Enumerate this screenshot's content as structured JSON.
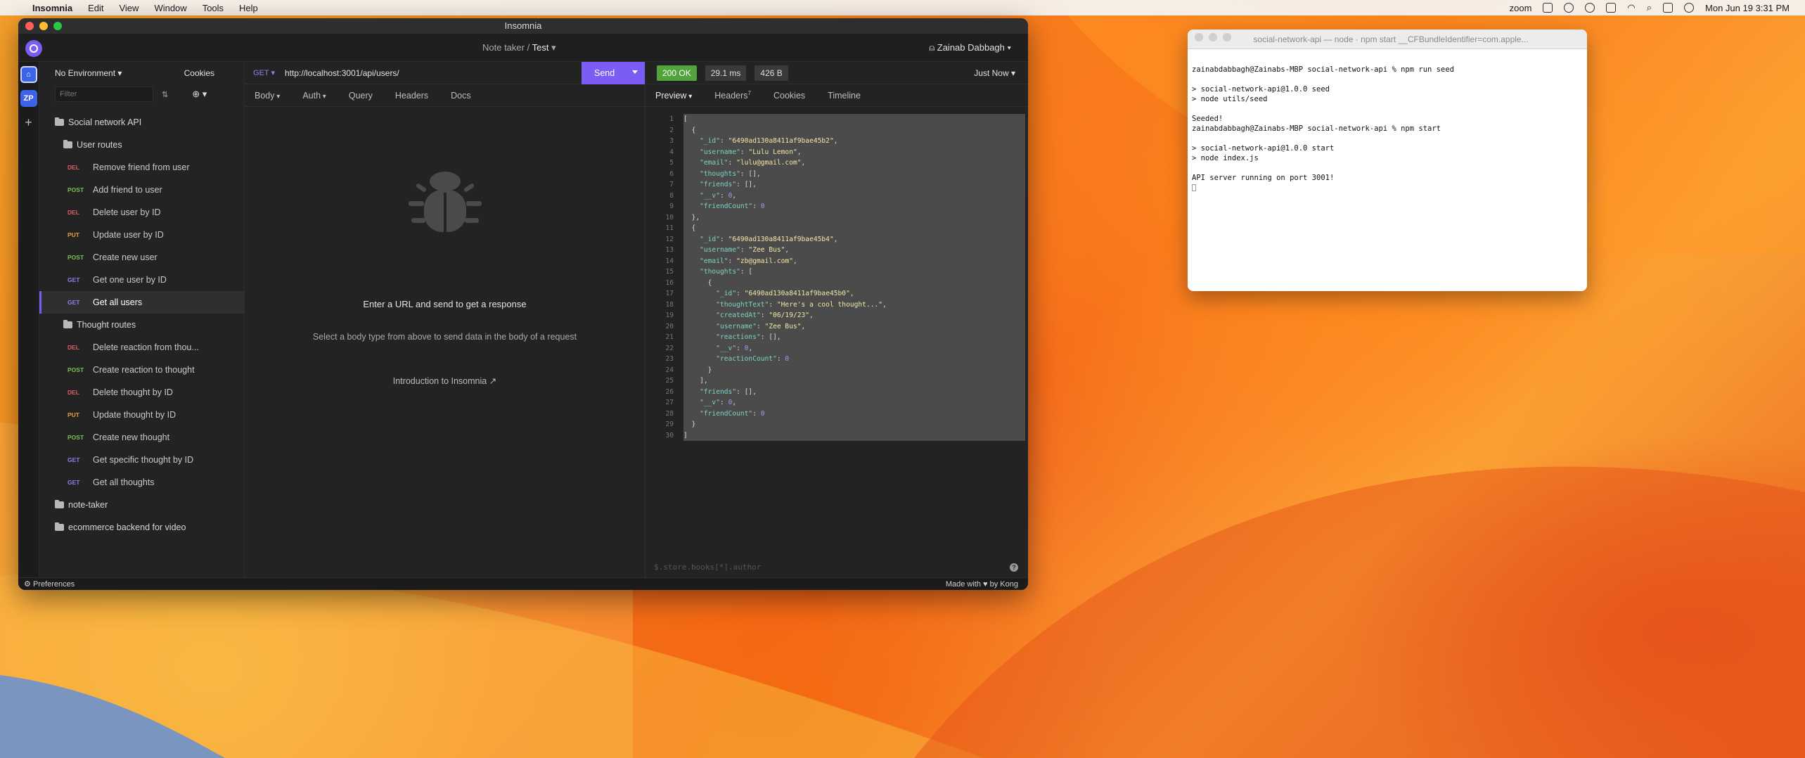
{
  "menubar": {
    "app": "Insomnia",
    "items": [
      "Edit",
      "View",
      "Window",
      "Tools",
      "Help"
    ],
    "zoom": "zoom",
    "datetime": "Mon Jun 19  3:31 PM"
  },
  "insomnia": {
    "window_title": "Insomnia",
    "breadcrumb_parent": "Note taker /",
    "breadcrumb_current": "Test",
    "user": "Zainab Dabbagh",
    "rail_workspace": "ZP",
    "environment": "No Environment",
    "cookies": "Cookies",
    "filter_placeholder": "Filter",
    "collection": "Social network API",
    "folders": {
      "user_routes": "User routes",
      "thought_routes": "Thought routes"
    },
    "user_requests": [
      {
        "method": "DEL",
        "name": "Remove friend from user"
      },
      {
        "method": "POST",
        "name": "Add friend to user"
      },
      {
        "method": "DEL",
        "name": "Delete user by ID"
      },
      {
        "method": "PUT",
        "name": "Update user by ID"
      },
      {
        "method": "POST",
        "name": "Create new user"
      },
      {
        "method": "GET",
        "name": "Get one user by ID"
      },
      {
        "method": "GET",
        "name": "Get all users"
      }
    ],
    "thought_requests": [
      {
        "method": "DEL",
        "name": "Delete reaction from thou..."
      },
      {
        "method": "POST",
        "name": "Create reaction to thought"
      },
      {
        "method": "DEL",
        "name": "Delete thought by ID"
      },
      {
        "method": "PUT",
        "name": "Update thought by ID"
      },
      {
        "method": "POST",
        "name": "Create new thought"
      },
      {
        "method": "GET",
        "name": "Get specific thought by ID"
      },
      {
        "method": "GET",
        "name": "Get all thoughts"
      }
    ],
    "other_folders": [
      "note-taker",
      "ecommerce backend for video"
    ],
    "request": {
      "method": "GET",
      "url": "http://localhost:3001/api/users/",
      "send": "Send",
      "tabs": [
        "Body",
        "Auth",
        "Query",
        "Headers",
        "Docs"
      ],
      "empty_title": "Enter a URL and send to get a response",
      "empty_sub": "Select a body type from above to send data in the body of a request",
      "empty_link": "Introduction to Insomnia"
    },
    "response": {
      "status": "200 OK",
      "time": "29.1 ms",
      "size": "426 B",
      "when": "Just Now",
      "tabs": [
        "Preview",
        "Headers",
        "Cookies",
        "Timeline"
      ],
      "headers_count": "7",
      "filter_placeholder": "$.store.books[*].author",
      "lines": [
        "[",
        "  {",
        "    \"_id\": \"6490ad130a8411af9bae45b2\",",
        "    \"username\": \"Lulu Lemon\",",
        "    \"email\": \"lulu@gmail.com\",",
        "    \"thoughts\": [],",
        "    \"friends\": [],",
        "    \"__v\": 0,",
        "    \"friendCount\": 0",
        "  },",
        "  {",
        "    \"_id\": \"6490ad130a8411af9bae45b4\",",
        "    \"username\": \"Zee Bus\",",
        "    \"email\": \"zb@gmail.com\",",
        "    \"thoughts\": [",
        "      {",
        "        \"_id\": \"6490ad130a8411af9bae45b0\",",
        "        \"thoughtText\": \"Here's a cool thought...\",",
        "        \"createdAt\": \"06/19/23\",",
        "        \"username\": \"Zee Bus\",",
        "        \"reactions\": [],",
        "        \"__v\": 0,",
        "        \"reactionCount\": 0",
        "      }",
        "    ],",
        "    \"friends\": [],",
        "    \"__v\": 0,",
        "    \"friendCount\": 0",
        "  }",
        "]"
      ]
    },
    "status_left": "Preferences",
    "status_right": "Made with ♥ by Kong"
  },
  "terminal": {
    "title": "social-network-api — node · npm start __CFBundleIdentifier=com.apple...",
    "lines": [
      "",
      "zainabdabbagh@Zainabs-MBP social-network-api % npm run seed",
      "",
      "> social-network-api@1.0.0 seed",
      "> node utils/seed",
      "",
      "Seeded!",
      "zainabdabbagh@Zainabs-MBP social-network-api % npm start",
      "",
      "> social-network-api@1.0.0 start",
      "> node index.js",
      "",
      "API server running on port 3001!"
    ]
  }
}
